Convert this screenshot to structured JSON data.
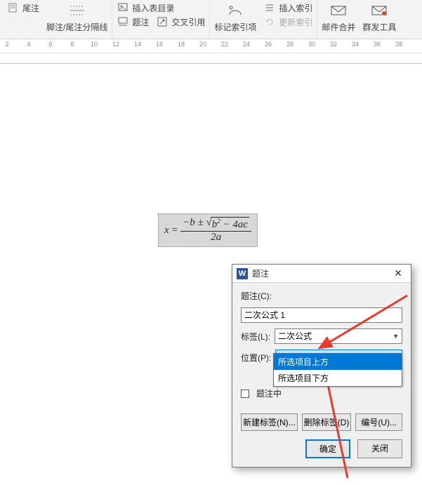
{
  "ribbon": {
    "group_footnote": {
      "item1": "尾注",
      "separator": "脚注/尾注分隔线"
    },
    "group_caption": {
      "insert_tof": "插入表目录",
      "caption": "题注",
      "crossref": "交叉引用"
    },
    "group_index": {
      "insert_index": "插入索引",
      "mark_entry": "标记索引项",
      "update_index": "更新索引"
    },
    "group_mail": {
      "mailmerge": "邮件合并",
      "mass_tools": "群发工具"
    }
  },
  "ruler": {
    "ticks": [
      "2",
      "4",
      "6",
      "8",
      "10",
      "12",
      "14",
      "16",
      "18",
      "20",
      "22",
      "24",
      "26",
      "28",
      "30",
      "32",
      "34",
      "36",
      "38"
    ]
  },
  "equation": {
    "lhs": "x",
    "eq": "=",
    "neg_b": "−b ±",
    "b2": "b",
    "minus": "− 4ac",
    "den": "2a"
  },
  "dialog": {
    "title": "题注",
    "caption_label": "题注(C):",
    "caption_value": "二次公式 1",
    "label_label": "标签(L):",
    "label_value": "二次公式",
    "position_label": "位置(P):",
    "position_value": "所选项目下方",
    "options": {
      "above": "所选项目上方",
      "below": "所选项目下方"
    },
    "exclude_checkbox": "题注中",
    "new_label": "新建标签(N)...",
    "delete_label": "删除标签(D)",
    "numbering": "编号(U)...",
    "ok": "确定",
    "close": "关闭"
  }
}
